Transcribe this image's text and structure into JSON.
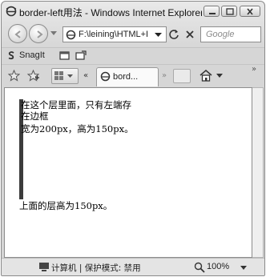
{
  "window": {
    "title": "border-left用法 - Windows Internet Explorer",
    "minimize_icon": "minimize-icon",
    "maximize_icon": "maximize-icon",
    "close_icon": "close-icon"
  },
  "address_bar": {
    "value": "F:\\leining\\HTML+I",
    "icon": "ie-page-icon"
  },
  "search": {
    "placeholder": "Google"
  },
  "toolbar": {
    "snagit_label": "SnagIt"
  },
  "tabs": [
    {
      "label": "bord..."
    }
  ],
  "page": {
    "line1": "在这个层里面，只有左端存",
    "line2": "在边框",
    "line3": "宽为200px，高为150px。",
    "line4": "上面的层高为150px。"
  },
  "status": {
    "zone_text": "计算机 | 保护模式: 禁用",
    "zoom": "100%"
  },
  "colors": {
    "border_left": "#3c3c3c",
    "window_bg": "#d6d6d6"
  }
}
